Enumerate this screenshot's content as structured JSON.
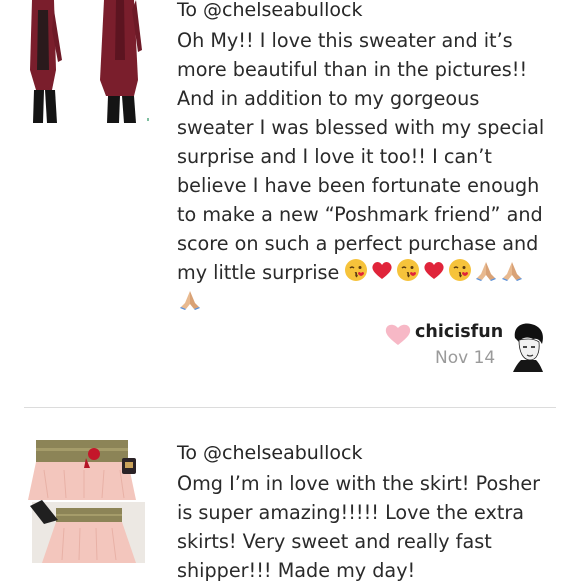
{
  "reviews": [
    {
      "to_label": "To @chelseabullock",
      "text": "Oh My!! I love this sweater and it’s\nmore beautiful than in the pictures!!\nAnd in addition to my gorgeous\nsweater I was blessed with my special\nsurprise and I love it too!! I can’t\nbelieve I have been fortunate enough\nto make a new “Poshmark friend” and\nscore on such a perfect purchase and\nmy little surprise",
      "emojis": [
        "kissing-face",
        "red-heart",
        "kissing-face",
        "red-heart",
        "kissing-face",
        "praying-hands",
        "praying-hands",
        "praying-hands"
      ],
      "reviewer": "chicisfun",
      "date": "Nov 14",
      "icons": {
        "heart": "heart-icon",
        "avatar": "reviewer-avatar"
      }
    },
    {
      "to_label": "To @chelseabullock",
      "text": "Omg I’m in love with the skirt! Posher\nis super amazing!!!!! Love the extra\nskirts! Very sweet and really fast\nshipper!!! Made my day!"
    }
  ],
  "colors": {
    "heart": "#f7b8c6",
    "date": "#9a9a9a",
    "divider": "#dcdcdc"
  }
}
